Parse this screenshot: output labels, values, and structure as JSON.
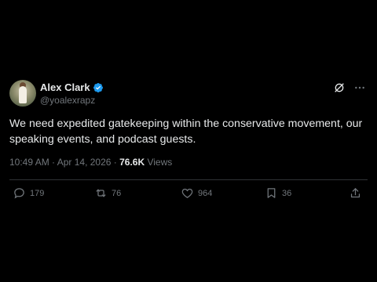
{
  "author": {
    "display_name": "Alex Clark",
    "handle": "@yoalexrapz"
  },
  "tweet": {
    "text": "We need expedited gatekeeping within the conservative movement, our speaking events, and podcast guests."
  },
  "meta": {
    "time": "10:49 AM",
    "separator1": " · ",
    "date": "Apr 14, 2026",
    "separator2": " · ",
    "views_count": "76.6K",
    "views_label": " Views"
  },
  "actions": {
    "replies": "179",
    "reposts": "76",
    "likes": "964",
    "bookmarks": "36"
  },
  "icons": {
    "verified": "verified-badge-icon",
    "grok": "grok-icon",
    "more": "more-icon",
    "reply": "reply-icon",
    "repost": "repost-icon",
    "like": "heart-icon",
    "bookmark": "bookmark-icon",
    "share": "share-icon"
  },
  "colors": {
    "background": "#000000",
    "text": "#e7e9ea",
    "muted": "#71767b",
    "verified": "#1d9bf0",
    "divider": "#2f3336"
  }
}
